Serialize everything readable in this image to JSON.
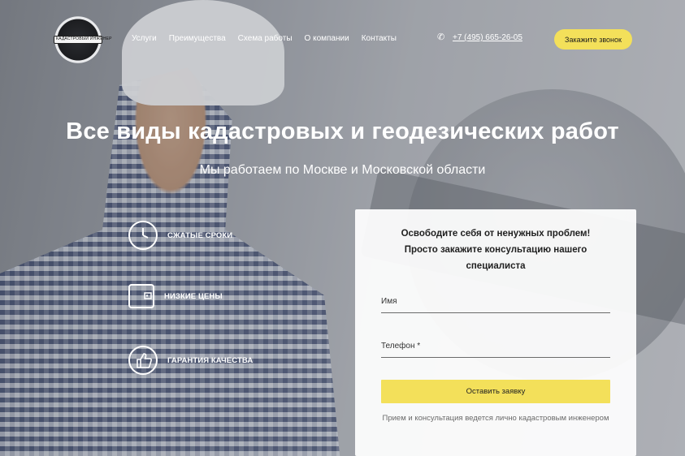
{
  "header": {
    "logo_text": "КАДАСТРОВЫЙ ИНЖЕНЕР",
    "nav": [
      "Услуги",
      "Преимущества",
      "Схема работы",
      "О компании",
      "Контакты"
    ],
    "phone": "+7 (495) 665-26-05",
    "call_button": "Закажите звонок"
  },
  "hero": {
    "title": "Все виды кадастровых и геодезических работ",
    "subtitle": "Мы работаем по Москве и Московской области"
  },
  "features": [
    {
      "label": "СЖАТЫЕ СРОКИ",
      "icon": "clock-icon"
    },
    {
      "label": "НИЗКИЕ ЦЕНЫ",
      "icon": "wallet-icon"
    },
    {
      "label": "ГАРАНТИЯ КАЧЕСТВА",
      "icon": "thumbs-up-icon"
    }
  ],
  "form": {
    "title_line1": "Освободите себя от ненужных проблем!",
    "title_line2": "Просто закажите консультацию нашего",
    "title_line3": "специалиста",
    "name_placeholder": "Имя",
    "phone_placeholder": "Телефон *",
    "submit": "Оставить заявку",
    "note": "Прием и консультация ведется лично кадастровым инженером"
  },
  "colors": {
    "accent": "#f3e05a",
    "text_on_dark": "#ffffff"
  }
}
